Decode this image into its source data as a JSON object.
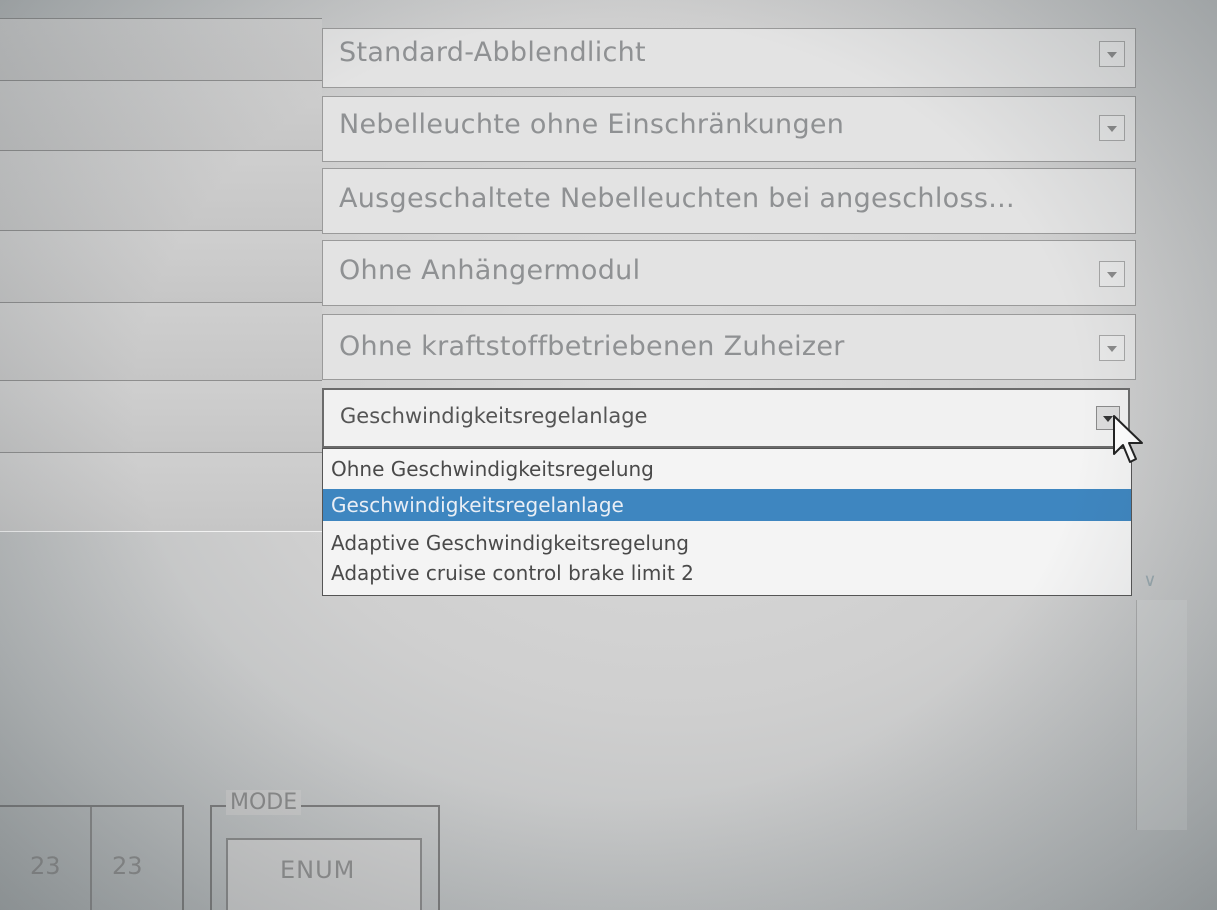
{
  "fields": [
    {
      "id": "field-1",
      "value": "Standard-Abblendlicht",
      "has_arrow": true
    },
    {
      "id": "field-2",
      "value": "Nebelleuchte ohne Einschränkungen",
      "has_arrow": true
    },
    {
      "id": "field-3",
      "value": "Ausgeschaltete Nebelleuchten bei angeschloss...",
      "has_arrow": false
    },
    {
      "id": "field-4",
      "value": "Ohne Anhängermodul",
      "has_arrow": true
    },
    {
      "id": "field-5",
      "value": "Ohne kraftstoffbetriebenen Zuheizer",
      "has_arrow": true
    }
  ],
  "active_dropdown": {
    "selected_value": "Geschwindigkeitsregelanlage",
    "options": [
      "Ohne Geschwindigkeitsregelung",
      "Geschwindigkeitsregelanlage",
      "Adaptive Geschwindigkeitsregelung",
      "Adaptive cruise control brake limit 2"
    ],
    "highlighted_index": 1
  },
  "bottom": {
    "number_a": "23",
    "number_b": "23",
    "mode_label": "MODE",
    "mode_value": "ENUM"
  }
}
